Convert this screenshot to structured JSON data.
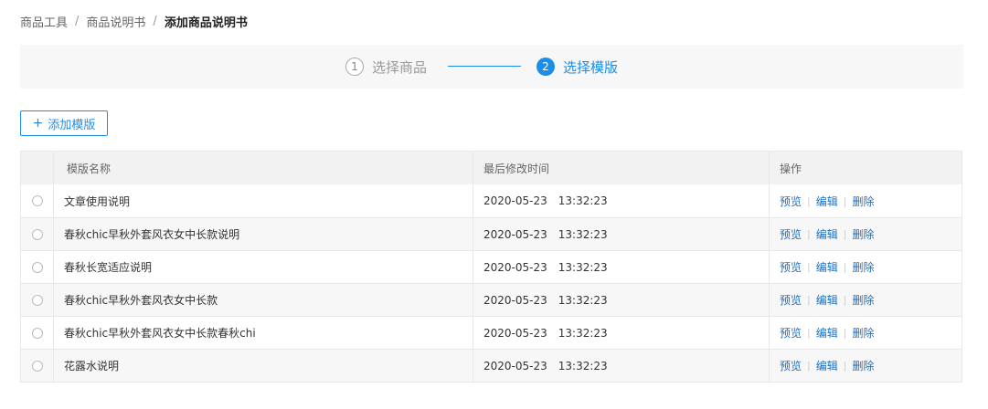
{
  "breadcrumb": {
    "items": [
      "商品工具",
      "商品说明书"
    ],
    "current": "添加商品说明书",
    "separator": "/"
  },
  "steps": [
    {
      "number": "1",
      "label": "选择商品",
      "state": "done"
    },
    {
      "number": "2",
      "label": "选择模版",
      "state": "active"
    }
  ],
  "toolbar": {
    "add_label": "添加模版",
    "add_icon": "plus-icon"
  },
  "table": {
    "headers": {
      "name": "模版名称",
      "time": "最后修改时间",
      "ops": "操作"
    },
    "rows": [
      {
        "name": "文章使用说明",
        "date": "2020-05-23",
        "time": "13:32:23"
      },
      {
        "name": "春秋chic早秋外套风衣女中长款说明",
        "date": "2020-05-23",
        "time": "13:32:23"
      },
      {
        "name": "春秋长宽适应说明",
        "date": "2020-05-23",
        "time": "13:32:23"
      },
      {
        "name": "春秋chic早秋外套风衣女中长款",
        "date": "2020-05-23",
        "time": "13:32:23"
      },
      {
        "name": "春秋chic早秋外套风衣女中长款春秋chi",
        "date": "2020-05-23",
        "time": "13:32:23"
      },
      {
        "name": "花露水说明",
        "date": "2020-05-23",
        "time": "13:32:23"
      }
    ],
    "actions": {
      "preview": "预览",
      "edit": "编辑",
      "delete": "删除",
      "separator": "|"
    }
  },
  "colors": {
    "accent": "#1d8ee8",
    "link": "#1d6fc0"
  }
}
